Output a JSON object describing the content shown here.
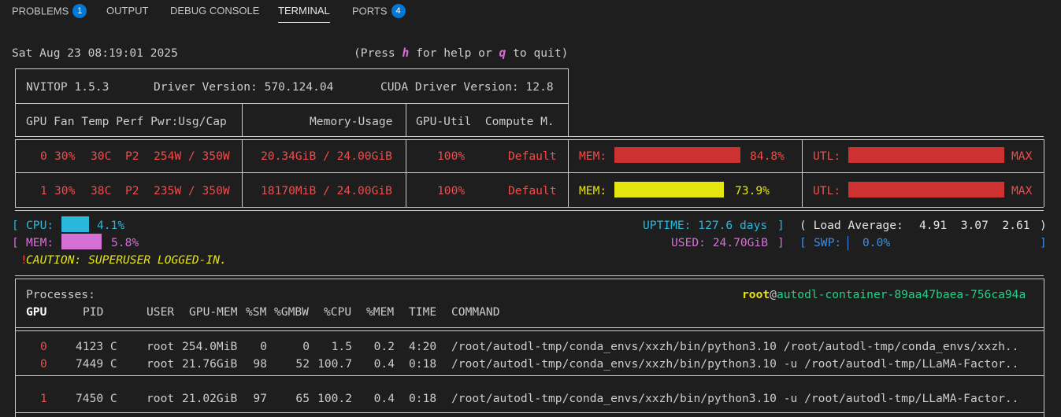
{
  "tabs": [
    {
      "label": "PROBLEMS",
      "badge": "1"
    },
    {
      "label": "OUTPUT"
    },
    {
      "label": "DEBUG CONSOLE"
    },
    {
      "label": "TERMINAL"
    },
    {
      "label": "PORTS",
      "badge": "4"
    }
  ],
  "terminal": {
    "datetime": "Sat Aug 23 08:19:01 2025",
    "help_pre": "(Press ",
    "help_h": "h",
    "help_mid": " for help or ",
    "help_q": "q",
    "help_post": " to quit)",
    "nvitop_version": "NVITOP 1.5.3",
    "driver_version": "Driver Version: 570.124.04",
    "cuda_version": "CUDA Driver Version: 12.8",
    "header_col1": "GPU Fan Temp Perf Pwr:Usg/Cap",
    "header_col2": "Memory-Usage",
    "header_col3": "GPU-Util  Compute M.",
    "gpus": [
      {
        "idx": "0",
        "fan": "30%",
        "temp": "30C",
        "perf": "P2",
        "power": "254W / 350W",
        "memory": "20.34GiB / 24.00GiB",
        "util": "100%",
        "compute": "Default",
        "mem_label": "MEM:",
        "mem_pct": "84.8%",
        "mem_frac": 0.848,
        "utl_label": "UTL:",
        "utl_val": "MAX",
        "utl_frac": 1.0
      },
      {
        "idx": "1",
        "fan": "30%",
        "temp": "38C",
        "perf": "P2",
        "power": "235W / 350W",
        "memory": "18170MiB / 24.00GiB",
        "util": "100%",
        "compute": "Default",
        "mem_label": "MEM:",
        "mem_pct": "73.9%",
        "mem_frac": 0.739,
        "utl_label": "UTL:",
        "utl_val": "MAX",
        "utl_frac": 1.0
      }
    ],
    "host": {
      "cpu_label": "CPU:",
      "cpu_pct": "4.1%",
      "cpu_frac": 0.041,
      "mem_label": "MEM:",
      "mem_pct": "5.8%",
      "mem_frac": 0.058,
      "uptime": "UPTIME: 127.6 days",
      "load_label": "( Load Average:",
      "load_values": "4.91  3.07  2.61",
      "used": "USED: 24.70GiB",
      "swp_label": "SWP:",
      "swp_pct": "0.0%",
      "caution_mark": "!",
      "caution_text": "CAUTION: SUPERUSER LOGGED-IN."
    },
    "processes": {
      "title": "Processes:",
      "user": "root",
      "at": "@",
      "hostname": "autodl-container-89aa47baea-756ca94a",
      "columns": {
        "gpu": "GPU",
        "pid": "PID",
        "user": "USER",
        "gpumem": "GPU-MEM",
        "sm": "%SM",
        "gmbw": "%GMBW",
        "cpu": "%CPU",
        "mem": "%MEM",
        "time": "TIME",
        "command": "COMMAND"
      },
      "rows": [
        {
          "gpu": "0",
          "pid": "4123 C",
          "user": "root",
          "gpumem": "254.0MiB",
          "sm": "0",
          "gmbw": "0",
          "cpu": "1.5",
          "mem": "0.2",
          "time": "4:20",
          "command": "/root/autodl-tmp/conda_envs/xxzh/bin/python3.10 /root/autodl-tmp/conda_envs/xxzh.."
        },
        {
          "gpu": "0",
          "pid": "7449 C",
          "user": "root",
          "gpumem": "21.76GiB",
          "sm": "98",
          "gmbw": "52",
          "cpu": "100.7",
          "mem": "0.4",
          "time": "0:18",
          "command": "/root/autodl-tmp/conda_envs/xxzh/bin/python3.10 -u /root/autodl-tmp/LLaMA-Factor.."
        },
        {
          "gpu": "1",
          "pid": "7450 C",
          "user": "root",
          "gpumem": "21.02GiB",
          "sm": "97",
          "gmbw": "65",
          "cpu": "100.2",
          "mem": "0.4",
          "time": "0:18",
          "command": "/root/autodl-tmp/conda_envs/xxzh/bin/python3.10 -u /root/autodl-tmp/LLaMA-Factor.."
        }
      ]
    }
  }
}
